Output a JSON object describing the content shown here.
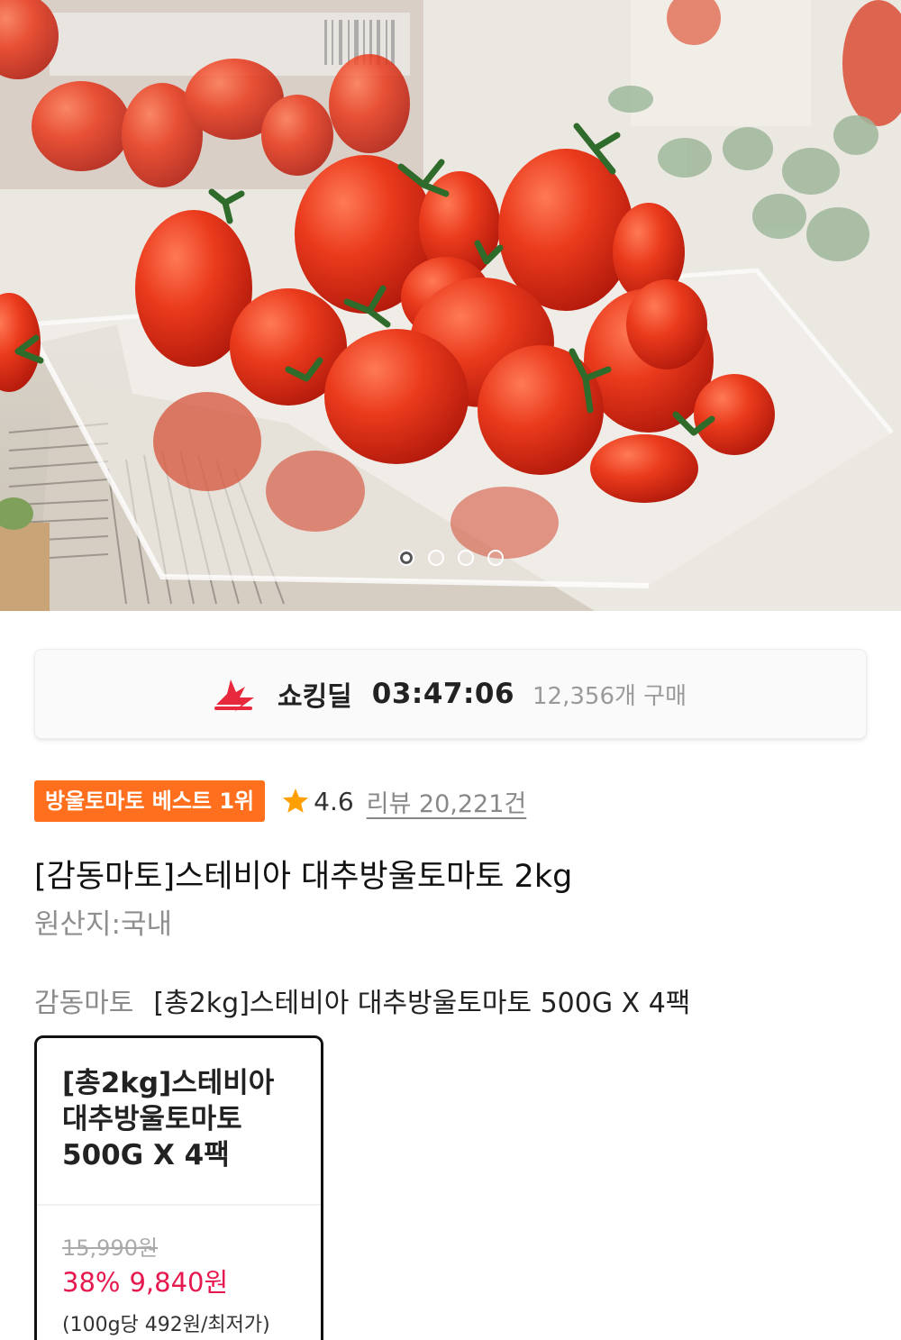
{
  "hero": {
    "image_alt": "",
    "carousel_total": 4,
    "carousel_active": 1
  },
  "deal": {
    "icon": "shocking-deal-bolt-icon",
    "label": "쇼킹딜",
    "timer": "03:47:06",
    "purchase_count": "12,356개 구매",
    "accent_color": "#e8283c"
  },
  "badge": {
    "text": "방울토마토 베스트 1위",
    "color": "#ff6f1d"
  },
  "rating": {
    "icon": "star-icon",
    "value": "4.6",
    "review_link": "리뷰 20,221건",
    "star_color": "#ff9f00"
  },
  "product": {
    "title": "[감동마토]스테비아 대추방울토마토 2kg",
    "origin": "원산지:국내"
  },
  "option": {
    "brand": "감동마토",
    "selected_name": "[총2kg]스테비아 대추방울토마토 500G X 4팩"
  },
  "card": {
    "title": "[총2kg]스테비아 대추방울토마토 500G X 4팩",
    "original_price": "15,990원",
    "discount": "38%",
    "sale_price": "9,840원",
    "unit_price": "(100g당 492원/최저가)",
    "sale_color": "#e6194f"
  }
}
